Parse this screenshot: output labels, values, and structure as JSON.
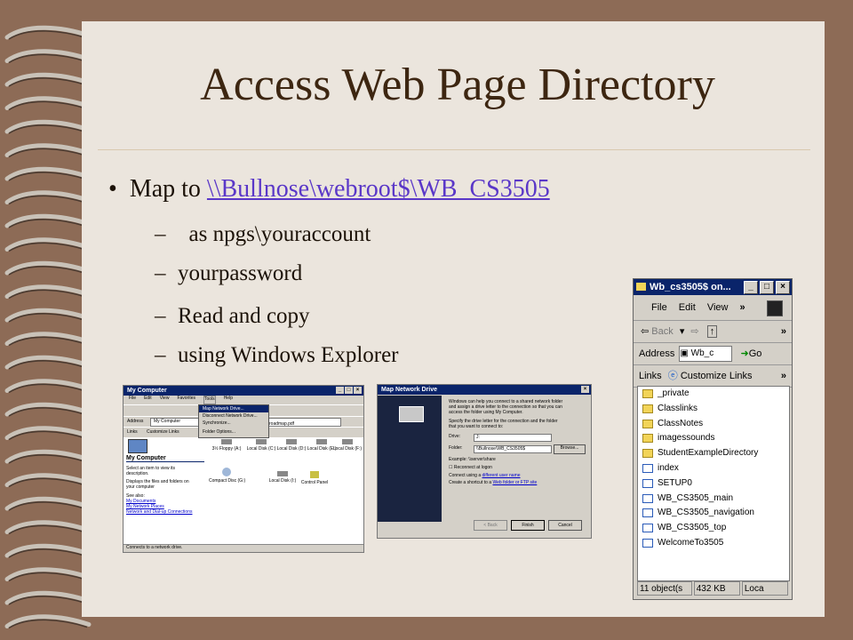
{
  "title": "Access Web Page Directory",
  "bullet": {
    "prefix": "Map to ",
    "link": "\\\\Bullnose\\webroot$\\WB_CS3505"
  },
  "sub_items": [
    "as npgs\\youraccount",
    "yourpassword",
    "Read and copy",
    "using Windows Explorer"
  ],
  "sub_dash": "–",
  "shot_mycomputer": {
    "title": "My Computer",
    "menu": [
      "File",
      "Edit",
      "View",
      "Favorites",
      "Tools",
      "Help"
    ],
    "tools_menu": [
      "Map Network Drive...",
      "Disconnect Network Drive...",
      "Synchronize...",
      "Folder Options..."
    ],
    "address_label": "Address",
    "address_value": "My Computer",
    "links": [
      "Links",
      "Customize Links"
    ],
    "side_title": "My Computer",
    "side_text": [
      "Select an item to view its",
      "description.",
      "Displays the files and folders on",
      "your computer"
    ],
    "see_also": "See also:",
    "see_links": [
      "My Documents",
      "My Network Places",
      "Network and Dial-up Connections"
    ],
    "drives": [
      "3½ Floppy (A:)",
      "Local Disk (C:)",
      "Local Disk (D:)",
      "Local Disk (E:)",
      "Local Disk (F:)",
      "Compact Disc (G:)",
      "Local Disk (I:)",
      "Control Panel"
    ],
    "file_name": "roadmap.pdf",
    "status": "Connects to a network drive."
  },
  "shot_mapdrive": {
    "title": "Map Network Drive",
    "para1": [
      "Windows can help you connect to a shared network folder",
      "and assign a drive letter to the connection so that you can",
      "access the folder using My Computer."
    ],
    "para2": [
      "Specify the drive letter for the connection and the folder",
      "that you want to connect to:"
    ],
    "drive_label": "Drive:",
    "drive_value": "J:",
    "folder_label": "Folder:",
    "folder_value": "\\\\Bullnose\\WB_CS3505$",
    "browse": "Browse...",
    "example": "Example: \\\\server\\share",
    "reconnect": "Reconnect at logon",
    "connect_prefix": "Connect using a ",
    "connect_link": "different user name",
    "create_prefix": "Create a shortcut to a ",
    "create_link": "Web folder or FTP site",
    "buttons": [
      "< Back",
      "Finish",
      "Cancel"
    ]
  },
  "explorer": {
    "title": "Wb_cs3505$ on...",
    "menu": [
      "File",
      "Edit",
      "View"
    ],
    "back": "Back",
    "address_label": "Address",
    "address_value": "Wb_c",
    "go": "Go",
    "links_label": "Links",
    "customize": "Customize Links",
    "chevron": "»",
    "files": [
      {
        "name": "_private",
        "kind": "folder"
      },
      {
        "name": "Classlinks",
        "kind": "folder"
      },
      {
        "name": "ClassNotes",
        "kind": "folder"
      },
      {
        "name": "imagessounds",
        "kind": "folder"
      },
      {
        "name": "StudentExampleDirectory",
        "kind": "folder"
      },
      {
        "name": "index",
        "kind": "page"
      },
      {
        "name": "SETUP0",
        "kind": "page"
      },
      {
        "name": "WB_CS3505_main",
        "kind": "page"
      },
      {
        "name": "WB_CS3505_navigation",
        "kind": "page"
      },
      {
        "name": "WB_CS3505_top",
        "kind": "page"
      },
      {
        "name": "WelcomeTo3505",
        "kind": "page"
      }
    ],
    "status": [
      "11 object(s",
      "432 KB",
      "Loca"
    ]
  }
}
